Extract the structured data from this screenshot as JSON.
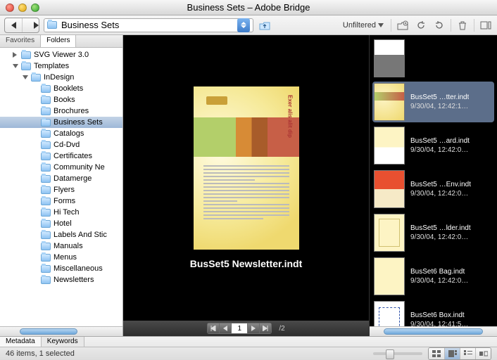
{
  "titlebar": {
    "title": "Business Sets – Adobe Bridge"
  },
  "toolbar": {
    "path": "Business Sets",
    "filter": "Unfiltered"
  },
  "sidebar": {
    "tabs": [
      "Favorites",
      "Folders"
    ],
    "active_tab": 1,
    "items": [
      {
        "depth": 1,
        "expand": "right",
        "label": "SVG Viewer 3.0"
      },
      {
        "depth": 1,
        "expand": "down",
        "label": "Templates"
      },
      {
        "depth": 2,
        "expand": "down",
        "label": "InDesign"
      },
      {
        "depth": 3,
        "expand": "",
        "label": "Booklets"
      },
      {
        "depth": 3,
        "expand": "",
        "label": "Books"
      },
      {
        "depth": 3,
        "expand": "",
        "label": "Brochures"
      },
      {
        "depth": 3,
        "expand": "",
        "label": "Business Sets",
        "selected": true
      },
      {
        "depth": 3,
        "expand": "",
        "label": "Catalogs"
      },
      {
        "depth": 3,
        "expand": "",
        "label": "Cd-Dvd"
      },
      {
        "depth": 3,
        "expand": "",
        "label": "Certificates"
      },
      {
        "depth": 3,
        "expand": "",
        "label": "Community Ne"
      },
      {
        "depth": 3,
        "expand": "",
        "label": "Datamerge"
      },
      {
        "depth": 3,
        "expand": "",
        "label": "Flyers"
      },
      {
        "depth": 3,
        "expand": "",
        "label": "Forms"
      },
      {
        "depth": 3,
        "expand": "",
        "label": "Hi Tech"
      },
      {
        "depth": 3,
        "expand": "",
        "label": "Hotel"
      },
      {
        "depth": 3,
        "expand": "",
        "label": "Labels And Stic"
      },
      {
        "depth": 3,
        "expand": "",
        "label": "Manuals"
      },
      {
        "depth": 3,
        "expand": "",
        "label": "Menus"
      },
      {
        "depth": 3,
        "expand": "",
        "label": "Miscellaneous"
      },
      {
        "depth": 3,
        "expand": "",
        "label": "Newsletters"
      }
    ]
  },
  "preview": {
    "doc_title": "Exer alis alit dip",
    "label": "BusSet5 Newsletter.indt",
    "page_current": "1",
    "page_total": "/2"
  },
  "thumbnails": [
    {
      "name": "",
      "date": "",
      "mini": "m0"
    },
    {
      "name": "BusSet5 …tter.indt",
      "date": "9/30/04, 12:42:1…",
      "mini": "m1",
      "selected": true
    },
    {
      "name": "BusSet5 …ard.indt",
      "date": "9/30/04, 12:42:0…",
      "mini": "m2"
    },
    {
      "name": "BusSet5 …Env.indt",
      "date": "9/30/04, 12:42:0…",
      "mini": "m3"
    },
    {
      "name": "BusSet5 …lder.indt",
      "date": "9/30/04, 12:42:0…",
      "mini": "m4"
    },
    {
      "name": "BusSet6 Bag.indt",
      "date": "9/30/04, 12:42:0…",
      "mini": "m5"
    },
    {
      "name": "BusSet6 Box.indt",
      "date": "9/30/04, 12:41:5…",
      "mini": "m6"
    }
  ],
  "bottom": {
    "tabs": [
      "Metadata",
      "Keywords"
    ],
    "active_tab": 0,
    "status": "46 items, 1 selected"
  }
}
